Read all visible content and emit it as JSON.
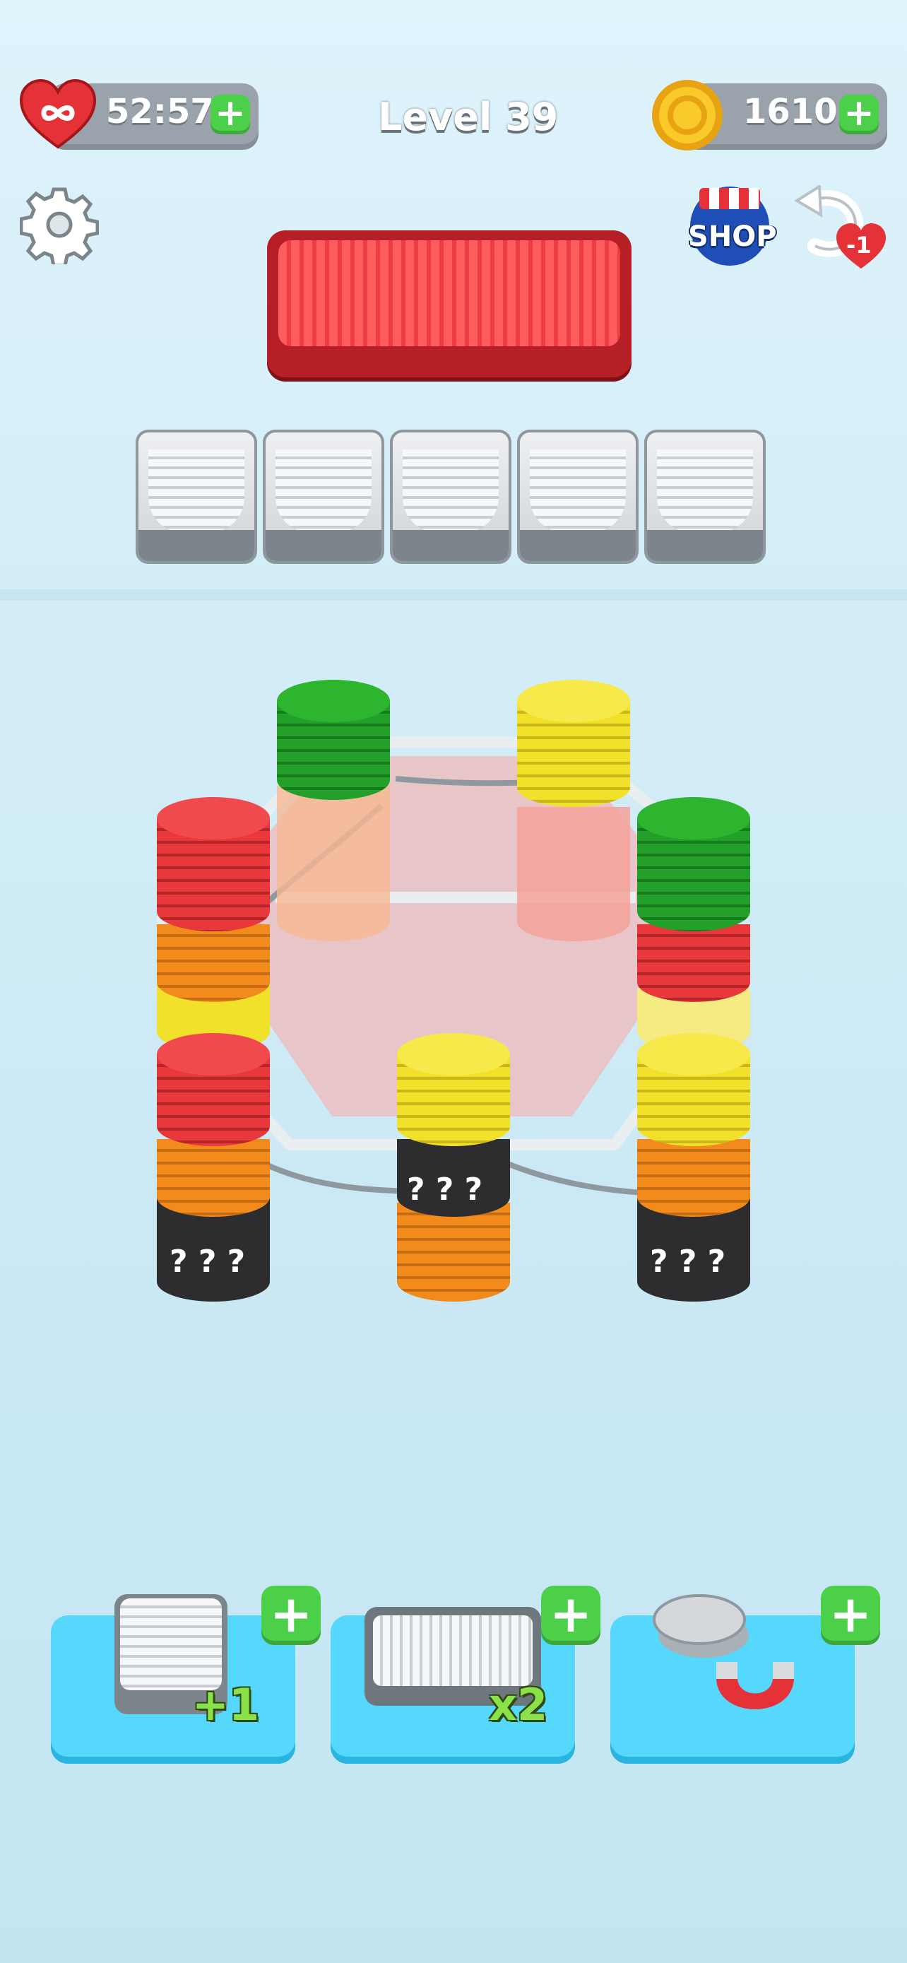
{
  "hud": {
    "lives_timer": "52:57",
    "level": "Level 39",
    "coins": "1610",
    "plus": "+",
    "shop_label": "SHOP",
    "undo_cost": "-1"
  },
  "icons": {
    "heart": "heart-infinity-icon",
    "coin": "coin-icon",
    "settings": "gear-icon",
    "shop": "shop-icon",
    "undo": "undo-icon"
  },
  "colors": {
    "red": "#e8383c",
    "green": "#22a02a",
    "yellow": "#f2e12a",
    "orange": "#f28a1c",
    "black": "#2d2d2f"
  },
  "stacks": [
    {
      "id": "top-left-back",
      "layers": [
        "orange",
        "green"
      ]
    },
    {
      "id": "top-right-back",
      "layers": [
        "red",
        "yellow"
      ]
    },
    {
      "id": "mid-left",
      "layers": [
        "yellow",
        "orange",
        "red"
      ]
    },
    {
      "id": "mid-right",
      "layers": [
        "yellow",
        "red",
        "green"
      ]
    },
    {
      "id": "bottom-left",
      "layers": [
        "hidden",
        "orange",
        "red"
      ],
      "hidden_marks": "? ? ?"
    },
    {
      "id": "bottom-center",
      "layers": [
        "orange",
        "hidden",
        "yellow"
      ],
      "hidden_marks": "? ? ?"
    },
    {
      "id": "bottom-right",
      "layers": [
        "hidden",
        "orange",
        "yellow"
      ],
      "hidden_marks": "? ? ?"
    }
  ],
  "boosters": [
    {
      "label": "+1",
      "plus": "+",
      "icon": "extra-slot-icon"
    },
    {
      "label": "x2",
      "plus": "+",
      "icon": "double-tray-icon"
    },
    {
      "label": "",
      "plus": "+",
      "icon": "magnet-icon"
    }
  ]
}
